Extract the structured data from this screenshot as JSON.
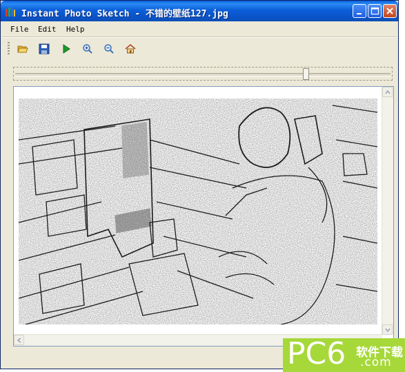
{
  "window": {
    "title": "Instant Photo Sketch - 不错的壁纸127.jpg",
    "controls": [
      "minimize-icon",
      "maximize-icon",
      "close-icon"
    ]
  },
  "menu": {
    "file": "File",
    "edit": "Edit",
    "help": "Help"
  },
  "toolbar": {
    "buttons": [
      "open-folder-icon",
      "save-icon",
      "play-icon",
      "zoom-in-icon",
      "zoom-out-icon",
      "home-icon"
    ]
  },
  "slider": {
    "value_fraction": 0.78
  },
  "image": {
    "description": "pencil sketch"
  },
  "watermark": {
    "brand": "PC6",
    "cn_text": "软件下载",
    "domain": ".com"
  },
  "colors": {
    "title_blue": "#0a5fd8",
    "window_bg": "#ece9d8",
    "watermark_green": "#a7d83a"
  }
}
